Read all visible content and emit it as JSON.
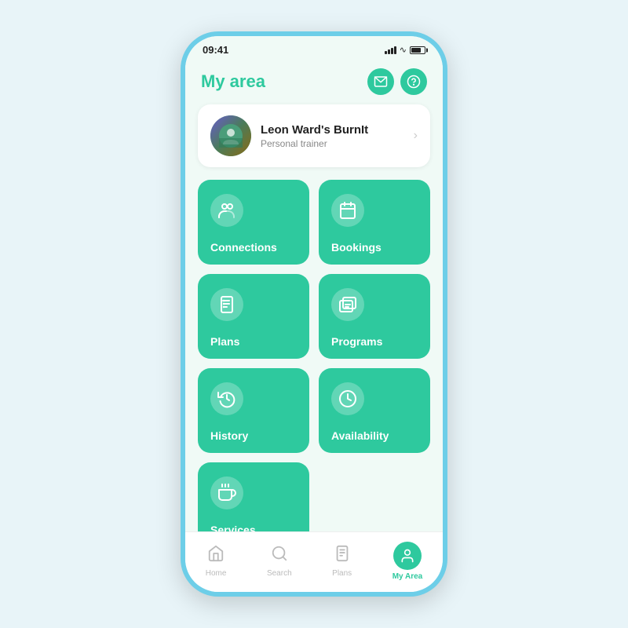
{
  "statusBar": {
    "time": "09:41"
  },
  "header": {
    "title": "My area",
    "mailIconLabel": "mail",
    "helpIconLabel": "help"
  },
  "profile": {
    "name": "Leon Ward's BurnIt",
    "role": "Personal trainer"
  },
  "gridItems": [
    {
      "id": "connections",
      "label": "Connections",
      "icon": "people"
    },
    {
      "id": "bookings",
      "label": "Bookings",
      "icon": "calendar"
    },
    {
      "id": "plans",
      "label": "Plans",
      "icon": "clipboard"
    },
    {
      "id": "programs",
      "label": "Programs",
      "icon": "layers"
    },
    {
      "id": "history",
      "label": "History",
      "icon": "clock-rotate"
    },
    {
      "id": "availability",
      "label": "Availability",
      "icon": "clock"
    },
    {
      "id": "services",
      "label": "Services",
      "icon": "hand-holding"
    }
  ],
  "bottomNav": [
    {
      "id": "home",
      "label": "Home",
      "icon": "home",
      "active": false
    },
    {
      "id": "search",
      "label": "Search",
      "icon": "search",
      "active": false
    },
    {
      "id": "plans",
      "label": "Plans",
      "icon": "clipboard-nav",
      "active": false
    },
    {
      "id": "my-area",
      "label": "My Area",
      "icon": "person",
      "active": true
    }
  ]
}
